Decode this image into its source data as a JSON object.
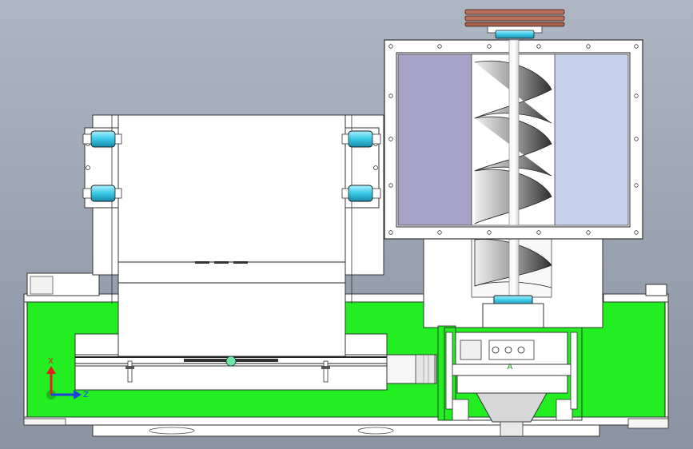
{
  "viewport": {
    "background_top": "#aeb6c2",
    "background_bottom": "#8a93a2"
  },
  "colors": {
    "frame_green": "#22ee22",
    "bearing_cyan": "#37c8e6",
    "pulley_copper": "#b8705a",
    "hopper_left_shade": "#a7a2c8",
    "hopper_right_shade": "#c8d2ec",
    "triad_x": "#e02020",
    "triad_z": "#2040e0",
    "triad_y": "#18b018"
  },
  "triad": {
    "x_label": "X",
    "z_label": "Z",
    "x_icon": "axis-x-arrow-icon",
    "z_icon": "axis-z-arrow-icon",
    "y_icon": "axis-y-marker-icon"
  },
  "annotations": {
    "section_marker": "A"
  }
}
